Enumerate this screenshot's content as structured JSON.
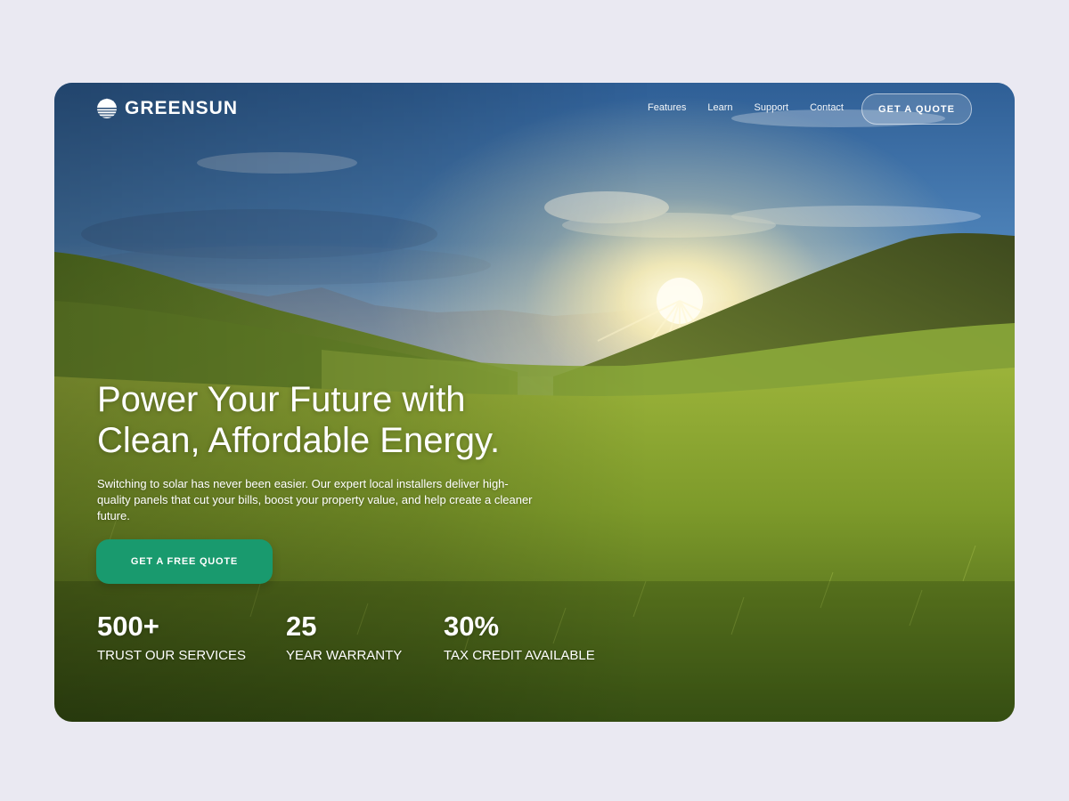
{
  "brand": {
    "name": "GREENSUN",
    "logo_icon": "sun-stripes-icon"
  },
  "nav": {
    "items": [
      {
        "label": "Features"
      },
      {
        "label": "Learn"
      },
      {
        "label": "Support"
      },
      {
        "label": "Contact"
      }
    ],
    "cta_label": "GET A QUOTE"
  },
  "hero": {
    "headline_line1": "Power Your Future with",
    "headline_line2": "Clean, Affordable Energy.",
    "subtext": "Switching to solar has never been easier. Our expert local installers deliver high-quality panels that cut your bills, boost your property value, and help create a cleaner future.",
    "cta_label": "GET A FREE QUOTE",
    "background": "sunrise-over-grassy-valley-image"
  },
  "stats": [
    {
      "value": "500+",
      "label": "TRUST OUR SERVICES"
    },
    {
      "value": "25",
      "label": "YEAR WARRANTY"
    },
    {
      "value": "30%",
      "label": "TAX CREDIT AVAILABLE"
    }
  ],
  "colors": {
    "page_background": "#EAE9F2",
    "accent_green": "#199A6E",
    "text_on_image": "#FFFFFF"
  }
}
